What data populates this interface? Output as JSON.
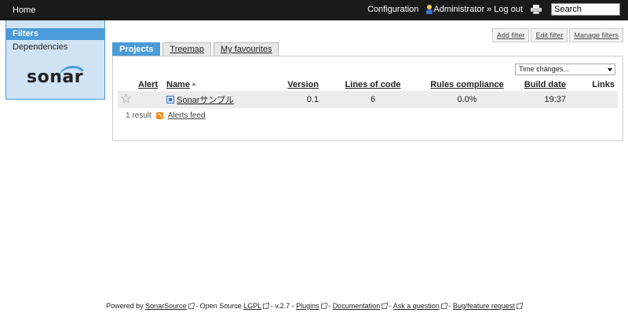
{
  "topbar": {
    "home": "Home",
    "configuration": "Configuration",
    "user": "Administrator",
    "separator": "»",
    "logout": "Log out",
    "search_placeholder": "Search"
  },
  "sidebar": {
    "filters": "Filters",
    "dependencies": "Dependencies",
    "logo_text": "sonar"
  },
  "filter_actions": {
    "add": "Add filter",
    "edit": "Edit filter",
    "manage": "Manage filters"
  },
  "tabs": [
    {
      "label": "Projects",
      "active": true
    },
    {
      "label": "Treemap",
      "active": false
    },
    {
      "label": "My favourites",
      "active": false
    }
  ],
  "time_select": "Time changes...",
  "table": {
    "headers": {
      "alert": "Alert",
      "name": "Name",
      "version": "Version",
      "loc": "Lines of code",
      "rules": "Rules compliance",
      "build": "Build date",
      "links": "Links"
    },
    "rows": [
      {
        "name": "Sonarサンプル",
        "version": "0.1",
        "loc": "6",
        "rules": "0.0%",
        "build": "19:37"
      }
    ]
  },
  "result_count": "1 result",
  "alerts_feed": "Alerts feed",
  "footer": {
    "powered": "Powered by",
    "sonarsource": "SonarSource",
    "open_source": "- Open Source",
    "lgpl": "LGPL",
    "version": "- v.2.7 -",
    "plugins": "Plugins",
    "dash1": "-",
    "documentation": "Documentation",
    "dash2": "-",
    "ask": "Ask a question",
    "dash3": "-",
    "bug": "Bug/feature request"
  },
  "colors": {
    "topbar": "#1a1a1a",
    "accent": "#4a9bd8",
    "sidebar_bg": "#cfe3f4"
  }
}
